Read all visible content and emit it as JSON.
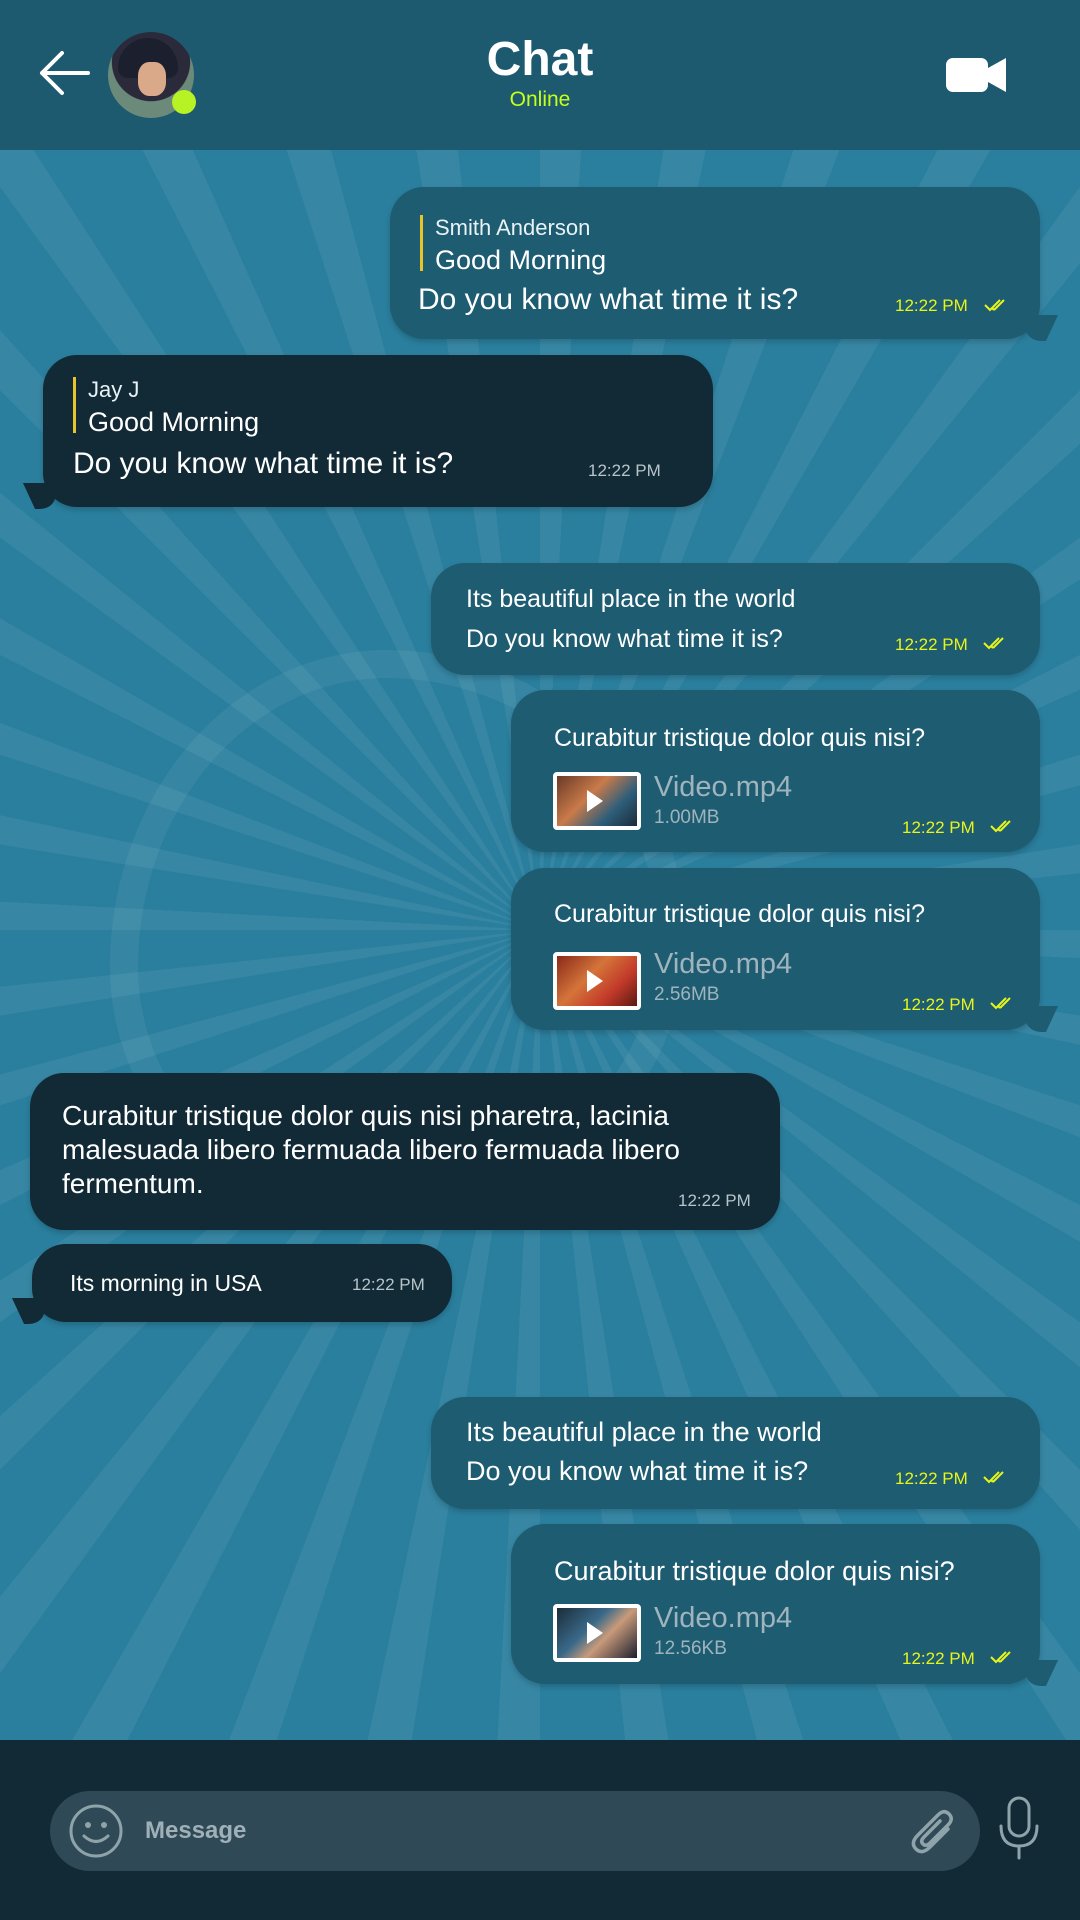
{
  "header": {
    "title": "Chat",
    "status": "Online"
  },
  "messages": [
    {
      "reply_name": "Smith Anderson",
      "reply_text": "Good Morning",
      "text": "Do you know what time it is?",
      "time": "12:22 PM"
    },
    {
      "reply_name": "Jay J",
      "reply_text": "Good Morning",
      "text": "Do you know what time it is?",
      "time": "12:22 PM"
    },
    {
      "line1": "Its beautiful place in the world",
      "line2": "Do you know what time it is?",
      "time": "12:22 PM"
    },
    {
      "text": "Curabitur tristique dolor quis nisi?",
      "file": "Video.mp4",
      "size": "1.00MB",
      "time": "12:22 PM"
    },
    {
      "text": "Curabitur tristique dolor quis nisi?",
      "file": "Video.mp4",
      "size": "2.56MB",
      "time": "12:22 PM"
    },
    {
      "text": "Curabitur tristique dolor quis nisi pharetra, lacinia malesuada libero fermuada libero fermuada libero fermentum.",
      "time": "12:22 PM"
    },
    {
      "text": "Its morning in USA",
      "time": "12:22 PM"
    },
    {
      "line1": "Its beautiful place in the world",
      "line2": "Do you know what time it is?",
      "time": "12:22 PM"
    },
    {
      "text": "Curabitur tristique dolor quis nisi?",
      "file": "Video.mp4",
      "size": "12.56KB",
      "time": "12:22 PM"
    }
  ],
  "composer": {
    "placeholder": "Message"
  },
  "colors": {
    "accent": "#c6ff1a",
    "header": "#1d5a70",
    "outgoing": "#1e5c72",
    "incoming": "#122a36",
    "background": "#2a7f9e"
  }
}
